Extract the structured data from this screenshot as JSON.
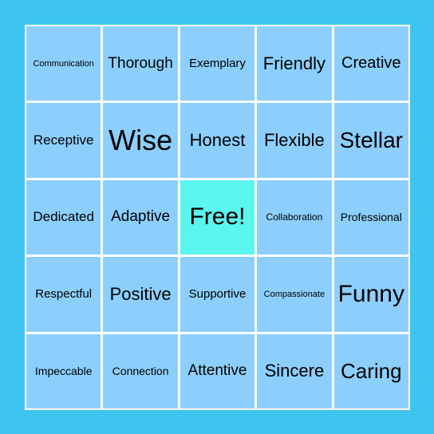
{
  "colors": {
    "background": "#3dc4ef",
    "cell": "#8ccffd",
    "free_cell": "#5af5ec",
    "grid_lines": "#ffffff"
  },
  "board": {
    "rows": [
      [
        "Communication",
        "Thorough",
        "Exemplary",
        "Friendly",
        "Creative"
      ],
      [
        "Receptive",
        "Wise",
        "Honest",
        "Flexible",
        "Stellar"
      ],
      [
        "Dedicated",
        "Adaptive",
        "Free!",
        "Collaboration",
        "Professional"
      ],
      [
        "Respectful",
        "Positive",
        "Supportive",
        "Compassionate",
        "Funny"
      ],
      [
        "Impeccable",
        "Connection",
        "Attentive",
        "Sincere",
        "Caring"
      ]
    ]
  }
}
